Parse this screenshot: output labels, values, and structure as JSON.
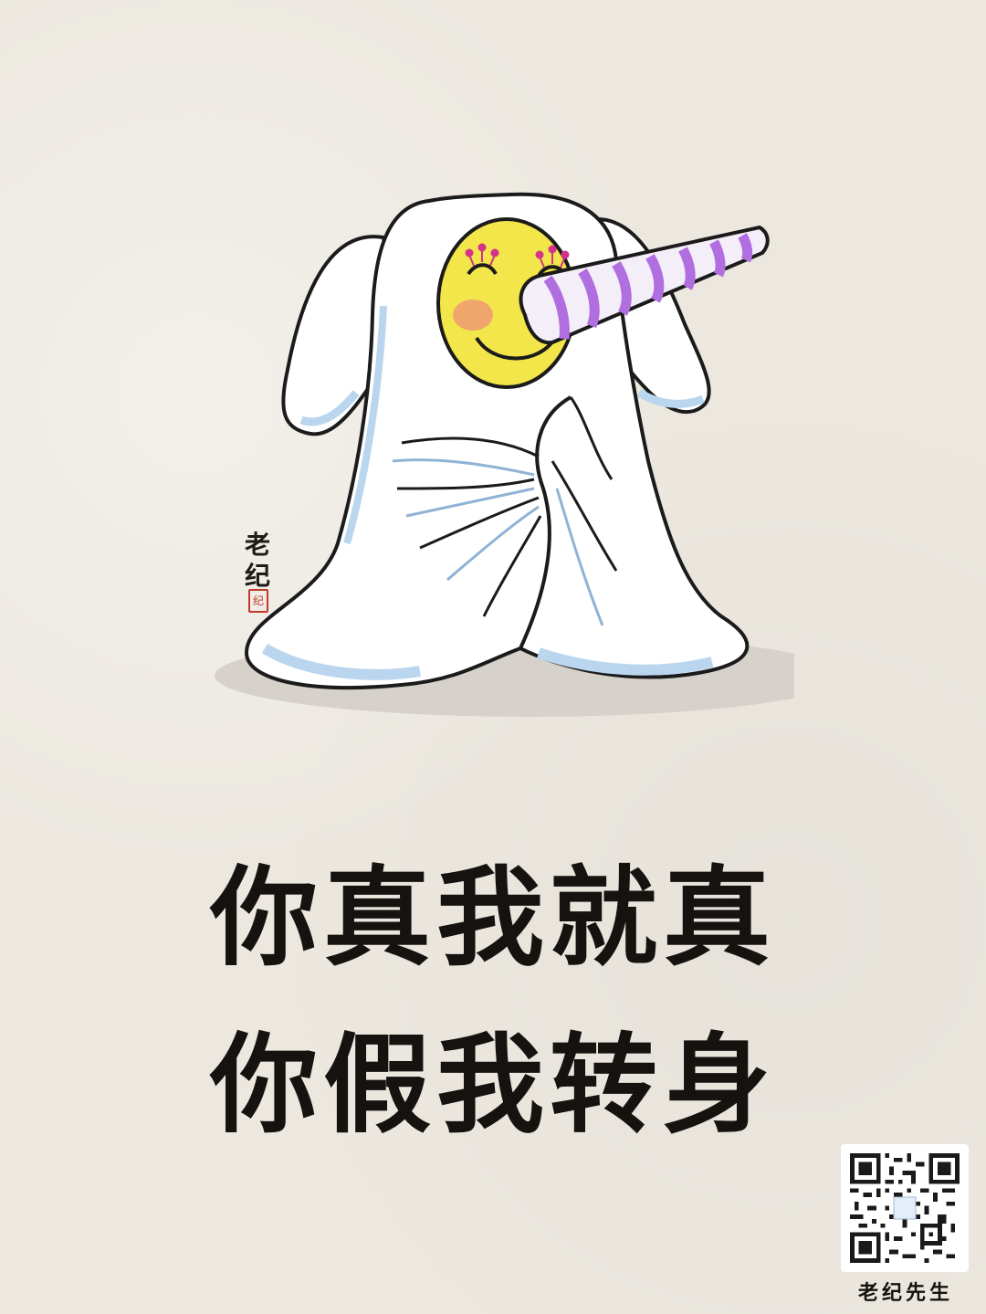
{
  "caption": {
    "line1": "你真我就真",
    "line2": "你假我转身"
  },
  "signature": {
    "name": "老纪",
    "seal_text": "纪"
  },
  "brand": {
    "name": "老纪先生"
  },
  "colors": {
    "paper": "#ece8e0",
    "face": "#f3e64a",
    "horn_stripe": "#b06ee0",
    "sheet": "#ffffff",
    "sheet_shadow": "#b9d6ee",
    "seal": "#c23a2a"
  },
  "icons": {
    "qr": "qr-code-icon"
  }
}
